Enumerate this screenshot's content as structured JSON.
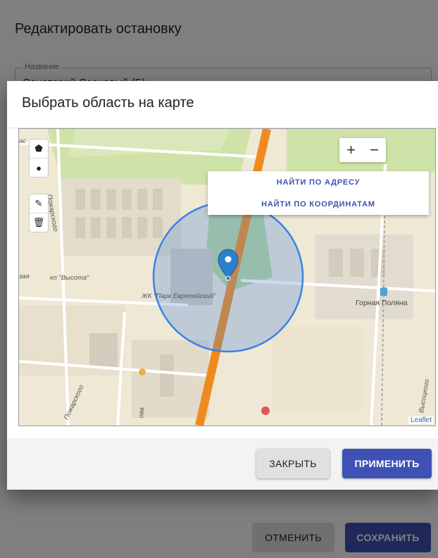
{
  "background_dialog": {
    "title": "Редактировать остановку",
    "name_field": {
      "label": "Название",
      "value": "Санаторий Сосновый (Б)"
    },
    "cancel_label": "ОТМЕНИТЬ",
    "save_label": "СОХРАНИТЬ"
  },
  "dialog": {
    "title": "Выбрать область на карте",
    "close_label": "ЗАКРЫТЬ",
    "apply_label": "ПРИМЕНИТЬ"
  },
  "map": {
    "find_by_address": "НАЙТИ ПО АДРЕСУ",
    "find_by_coordinates": "НАЙТИ ПО КООРДИНАТАМ",
    "zoom_in": "+",
    "zoom_out": "−",
    "attribution": "Leaflet",
    "labels": {
      "street_pozharskogo_top": "Пожарского",
      "street_pozharskogo_bottom": "Пожарского",
      "kp_vysota": "кп \"Высота\"",
      "zhk_park": "ЖК \"Парк Европейский\"",
      "gornaya_polyana": "Горная Поляна",
      "street_vysotskogo": "Высоцкого",
      "street_ova": "ова",
      "left_cut": "зая",
      "top_left_cut": "ас"
    },
    "tools": {
      "polygon": "⬟",
      "circle": "●",
      "edit": "✎",
      "delete": "🗑"
    },
    "colors": {
      "road": "#f0901e",
      "circle": "#3b82e6",
      "marker": "#2a81cb"
    }
  }
}
